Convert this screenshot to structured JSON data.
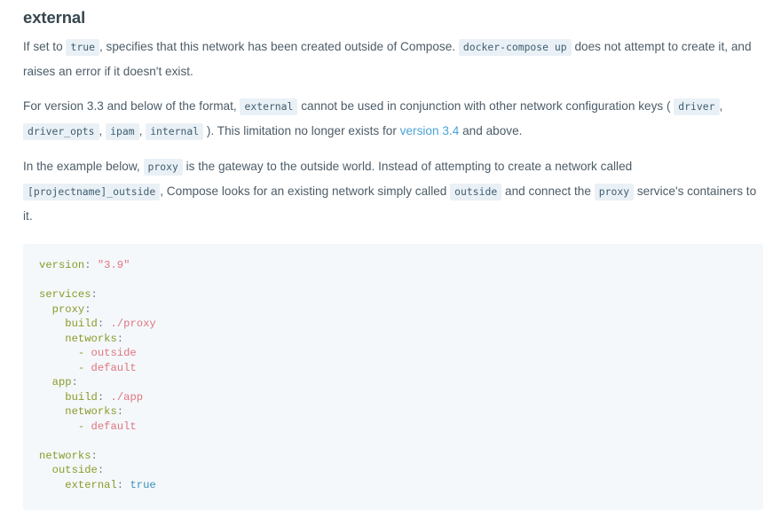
{
  "heading": {
    "text": "external"
  },
  "paragraphs": {
    "p1": {
      "s1": "If set to ",
      "code1": "true",
      "s2": ", specifies that this network has been created outside of Compose. ",
      "code2": "docker-compose up",
      "s3": " does not attempt to create it, and raises an error if it doesn't exist."
    },
    "p2": {
      "s1": "For version 3.3 and below of the format, ",
      "code1": "external",
      "s2": " cannot be used in conjunction with other network configuration keys ( ",
      "code2": "driver",
      "s3": ", ",
      "code3": "driver_opts",
      "s4": ", ",
      "code4": "ipam",
      "s5": ", ",
      "code5": "internal",
      "s6": " ). This limitation no longer exists for ",
      "link": "version 3.4",
      "s7": " and above."
    },
    "p3": {
      "s1": "In the example below, ",
      "code1": "proxy",
      "s2": " is the gateway to the outside world. Instead of attempting to create a network called ",
      "code2": "[projectname]_outside",
      "s3": ", Compose looks for an existing network simply called ",
      "code3": "outside",
      "s4": " and connect the ",
      "code4": "proxy",
      "s5": " service's containers to it."
    }
  },
  "code_block": {
    "language": "yaml",
    "lines": [
      {
        "indent": "",
        "parts": [
          {
            "t": "key",
            "v": "version"
          },
          {
            "t": "punct",
            "v": ":"
          },
          {
            "t": "plain",
            "v": " "
          },
          {
            "t": "str",
            "v": "\"3.9\""
          }
        ]
      },
      {
        "indent": "",
        "parts": []
      },
      {
        "indent": "",
        "parts": [
          {
            "t": "key",
            "v": "services"
          },
          {
            "t": "punct",
            "v": ":"
          }
        ]
      },
      {
        "indent": "  ",
        "parts": [
          {
            "t": "key",
            "v": "proxy"
          },
          {
            "t": "punct",
            "v": ":"
          }
        ]
      },
      {
        "indent": "    ",
        "parts": [
          {
            "t": "key",
            "v": "build"
          },
          {
            "t": "punct",
            "v": ":"
          },
          {
            "t": "plain",
            "v": " "
          },
          {
            "t": "val",
            "v": "./proxy"
          }
        ]
      },
      {
        "indent": "    ",
        "parts": [
          {
            "t": "key",
            "v": "networks"
          },
          {
            "t": "punct",
            "v": ":"
          }
        ]
      },
      {
        "indent": "      ",
        "parts": [
          {
            "t": "dash",
            "v": "-"
          },
          {
            "t": "plain",
            "v": " "
          },
          {
            "t": "val",
            "v": "outside"
          }
        ]
      },
      {
        "indent": "      ",
        "parts": [
          {
            "t": "dash",
            "v": "-"
          },
          {
            "t": "plain",
            "v": " "
          },
          {
            "t": "val",
            "v": "default"
          }
        ]
      },
      {
        "indent": "  ",
        "parts": [
          {
            "t": "key",
            "v": "app"
          },
          {
            "t": "punct",
            "v": ":"
          }
        ]
      },
      {
        "indent": "    ",
        "parts": [
          {
            "t": "key",
            "v": "build"
          },
          {
            "t": "punct",
            "v": ":"
          },
          {
            "t": "plain",
            "v": " "
          },
          {
            "t": "val",
            "v": "./app"
          }
        ]
      },
      {
        "indent": "    ",
        "parts": [
          {
            "t": "key",
            "v": "networks"
          },
          {
            "t": "punct",
            "v": ":"
          }
        ]
      },
      {
        "indent": "      ",
        "parts": [
          {
            "t": "dash",
            "v": "-"
          },
          {
            "t": "plain",
            "v": " "
          },
          {
            "t": "val",
            "v": "default"
          }
        ]
      },
      {
        "indent": "",
        "parts": []
      },
      {
        "indent": "",
        "parts": [
          {
            "t": "key",
            "v": "networks"
          },
          {
            "t": "punct",
            "v": ":"
          }
        ]
      },
      {
        "indent": "  ",
        "parts": [
          {
            "t": "key",
            "v": "outside"
          },
          {
            "t": "punct",
            "v": ":"
          }
        ]
      },
      {
        "indent": "    ",
        "parts": [
          {
            "t": "key",
            "v": "external"
          },
          {
            "t": "punct",
            "v": ":"
          },
          {
            "t": "plain",
            "v": " "
          },
          {
            "t": "bool",
            "v": "true"
          }
        ]
      }
    ]
  },
  "colors": {
    "heading": "#37474f",
    "body_text": "#4c5c68",
    "link": "#4aa3d8",
    "inline_code_bg": "#eaf1f6",
    "inline_code_fg": "#3f5d70",
    "code_block_bg": "#f4f8fb",
    "yaml_key": "#8a9a28",
    "yaml_string": "#e0757e",
    "yaml_bool": "#3d8fb8"
  }
}
